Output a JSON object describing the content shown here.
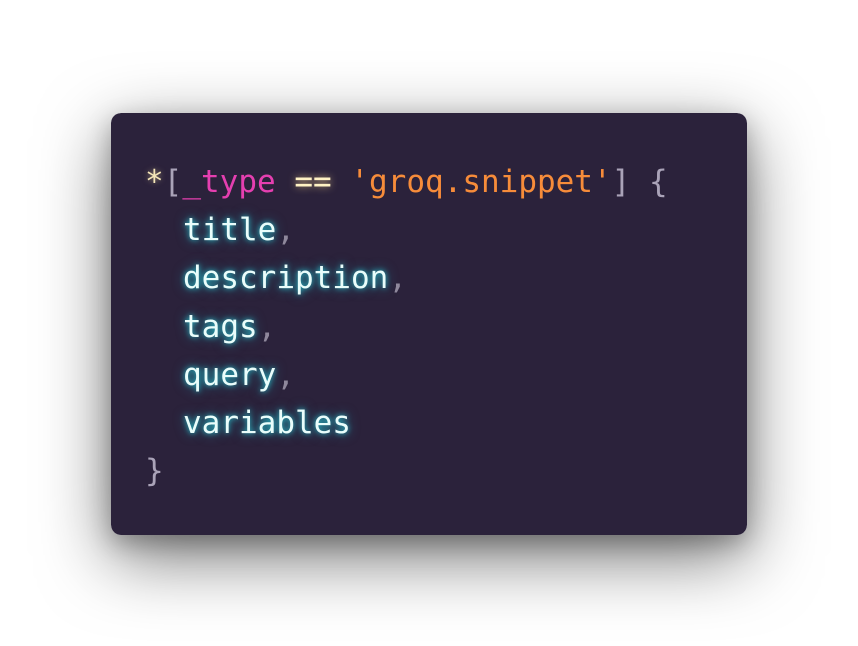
{
  "theme": {
    "page_background": "#ffffff",
    "editor_background": "#2b223b",
    "colors": {
      "star": "#f5e6b8",
      "bracket": "#aaa3b8",
      "field": "#e53fb0",
      "operator": "#fff2c4",
      "string": "#f78c3a",
      "attribute": "#e9fdfb",
      "punctuation": "#8f889c"
    }
  },
  "code": {
    "line1": {
      "star": "*",
      "open_bracket": "[",
      "field": "_type",
      "space1": " ",
      "operator": "==",
      "space2": " ",
      "string": "'groq.snippet'",
      "close_bracket": "]",
      "space3": " ",
      "open_brace": "{"
    },
    "projection": [
      {
        "name": "title",
        "separator": ","
      },
      {
        "name": "description",
        "separator": ","
      },
      {
        "name": "tags",
        "separator": ","
      },
      {
        "name": "query",
        "separator": ","
      },
      {
        "name": "variables",
        "separator": ""
      }
    ],
    "close_brace": "}"
  }
}
